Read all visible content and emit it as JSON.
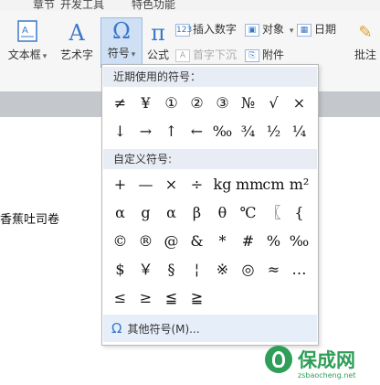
{
  "tabs": [
    "章节",
    "开发工具",
    "特色功能"
  ],
  "ribbon": {
    "textbox": "文本框",
    "wordart": "艺术字",
    "symbol": "符号",
    "formula": "公式",
    "insert_number": "插入数字",
    "object": "对象",
    "date": "日期",
    "dropcap": "首字下沉",
    "attachment": "附件",
    "comment": "批注"
  },
  "document": {
    "text": "香蕉吐司卷"
  },
  "symbol_menu": {
    "recent_title": "近期使用的符号：",
    "recent": [
      [
        "≠",
        "¥",
        "①",
        "②",
        "③",
        "№",
        "√",
        "×"
      ],
      [
        "↓",
        "→",
        "↑",
        "←",
        "‰",
        "¾",
        "½",
        "¼"
      ]
    ],
    "custom_title": "自定义符号:",
    "custom": [
      [
        "+",
        "—",
        "×",
        "÷",
        "kg",
        "mm",
        "cm",
        "m²"
      ],
      [
        "α",
        "g",
        "α",
        "β",
        "θ",
        "℃",
        "〖",
        "{"
      ],
      [
        "©",
        "®",
        "@",
        "&",
        "*",
        "#",
        "%",
        "‰"
      ],
      [
        "$",
        "￥",
        "§",
        "¦",
        "※",
        "◎",
        "≈",
        "…"
      ],
      [
        "≤",
        "≥",
        "≦",
        "≧"
      ]
    ],
    "more": "其他符号(M)..."
  },
  "watermark": {
    "title": "保成网",
    "url": "zsbaocheng.net"
  }
}
